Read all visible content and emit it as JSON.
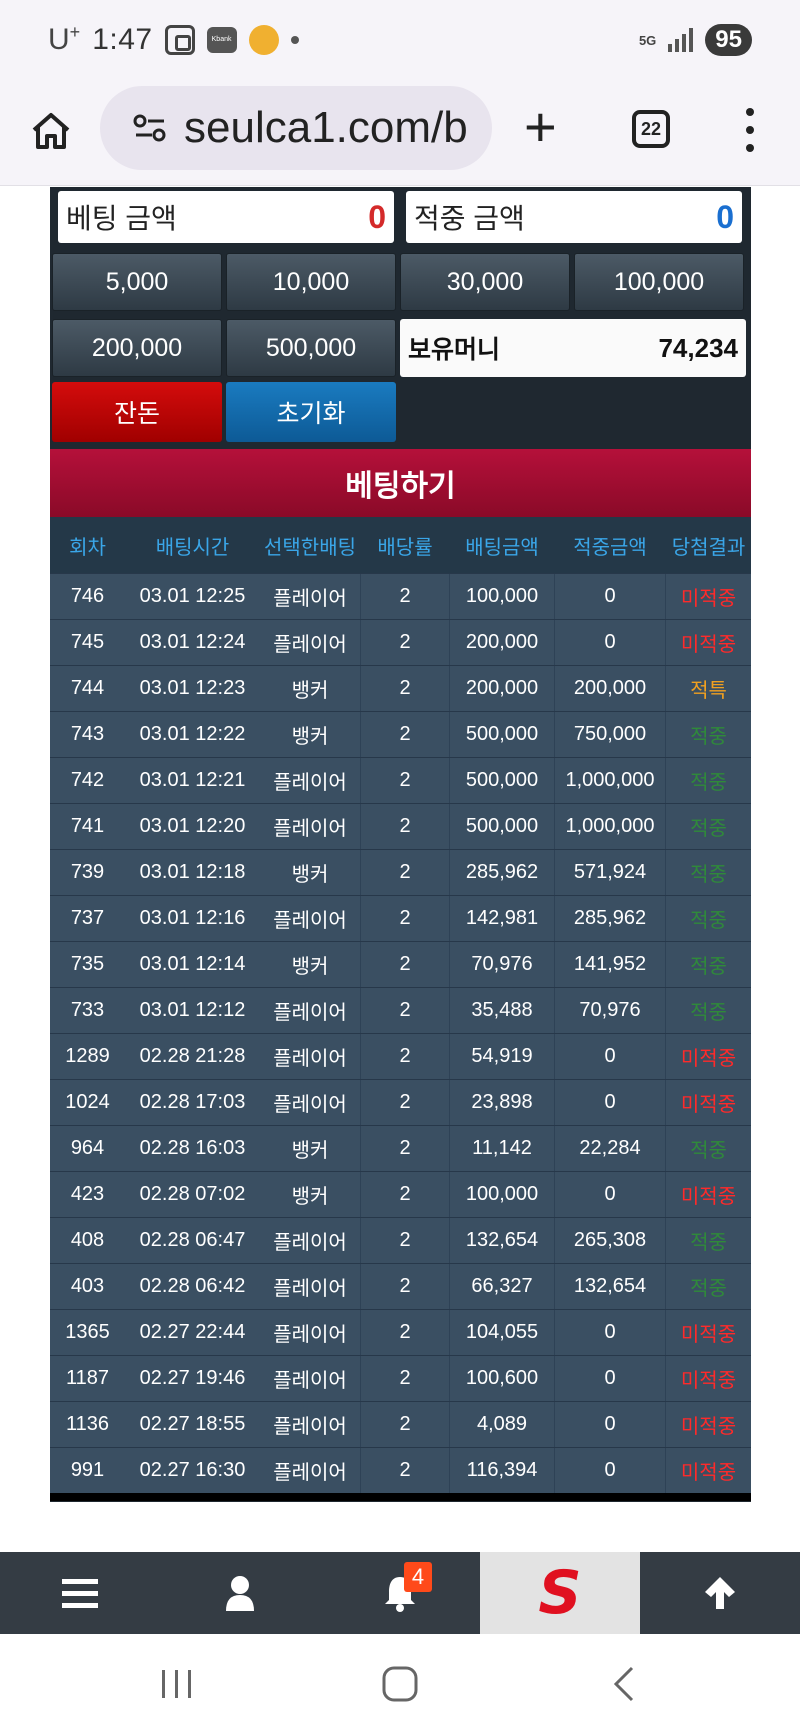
{
  "status_bar": {
    "carrier": "U",
    "carrier_sup": "+",
    "time": "1:47",
    "kbank_label": "Kbank",
    "network": "5G",
    "battery": "95"
  },
  "browser": {
    "url": "seulca1.com/b",
    "tab_count": "22"
  },
  "bet_panel": {
    "bet_amount_label": "베팅 금액",
    "bet_amount_value": "0",
    "hit_amount_label": "적중 금액",
    "hit_amount_value": "0",
    "chips": [
      "5,000",
      "10,000",
      "30,000",
      "100,000",
      "200,000",
      "500,000"
    ],
    "money_label": "보유머니",
    "money_value": "74,234",
    "balance_button": "잔돈",
    "reset_button": "초기화",
    "bet_button": "베팅하기"
  },
  "table": {
    "headers": [
      "회차",
      "배팅시간",
      "선택한배팅",
      "배당률",
      "배팅금액",
      "적중금액",
      "당첨결과"
    ],
    "rows": [
      [
        "746",
        "03.01 12:25",
        "플레이어",
        "2",
        "100,000",
        "0",
        "미적중"
      ],
      [
        "745",
        "03.01 12:24",
        "플레이어",
        "2",
        "200,000",
        "0",
        "미적중"
      ],
      [
        "744",
        "03.01 12:23",
        "뱅커",
        "2",
        "200,000",
        "200,000",
        "적특"
      ],
      [
        "743",
        "03.01 12:22",
        "뱅커",
        "2",
        "500,000",
        "750,000",
        "적중"
      ],
      [
        "742",
        "03.01 12:21",
        "플레이어",
        "2",
        "500,000",
        "1,000,000",
        "적중"
      ],
      [
        "741",
        "03.01 12:20",
        "플레이어",
        "2",
        "500,000",
        "1,000,000",
        "적중"
      ],
      [
        "739",
        "03.01 12:18",
        "뱅커",
        "2",
        "285,962",
        "571,924",
        "적중"
      ],
      [
        "737",
        "03.01 12:16",
        "플레이어",
        "2",
        "142,981",
        "285,962",
        "적중"
      ],
      [
        "735",
        "03.01 12:14",
        "뱅커",
        "2",
        "70,976",
        "141,952",
        "적중"
      ],
      [
        "733",
        "03.01 12:12",
        "플레이어",
        "2",
        "35,488",
        "70,976",
        "적중"
      ],
      [
        "1289",
        "02.28 21:28",
        "플레이어",
        "2",
        "54,919",
        "0",
        "미적중"
      ],
      [
        "1024",
        "02.28 17:03",
        "플레이어",
        "2",
        "23,898",
        "0",
        "미적중"
      ],
      [
        "964",
        "02.28 16:03",
        "뱅커",
        "2",
        "11,142",
        "22,284",
        "적중"
      ],
      [
        "423",
        "02.28 07:02",
        "뱅커",
        "2",
        "100,000",
        "0",
        "미적중"
      ],
      [
        "408",
        "02.28 06:47",
        "플레이어",
        "2",
        "132,654",
        "265,308",
        "적중"
      ],
      [
        "403",
        "02.28 06:42",
        "플레이어",
        "2",
        "66,327",
        "132,654",
        "적중"
      ],
      [
        "1365",
        "02.27 22:44",
        "플레이어",
        "2",
        "104,055",
        "0",
        "미적중"
      ],
      [
        "1187",
        "02.27 19:46",
        "플레이어",
        "2",
        "100,600",
        "0",
        "미적중"
      ],
      [
        "1136",
        "02.27 18:55",
        "플레이어",
        "2",
        "4,089",
        "0",
        "미적중"
      ],
      [
        "991",
        "02.27 16:30",
        "플레이어",
        "2",
        "116,394",
        "0",
        "미적중"
      ]
    ]
  },
  "site_nav": {
    "notification_count": "4",
    "logo_letter": "S"
  },
  "colors": {
    "lose": "#ff2a2a",
    "win": "#2f8a3a",
    "special": "#f0a020",
    "bet_amount": "#d42a2a",
    "hit_amount": "#1a6fd0"
  }
}
